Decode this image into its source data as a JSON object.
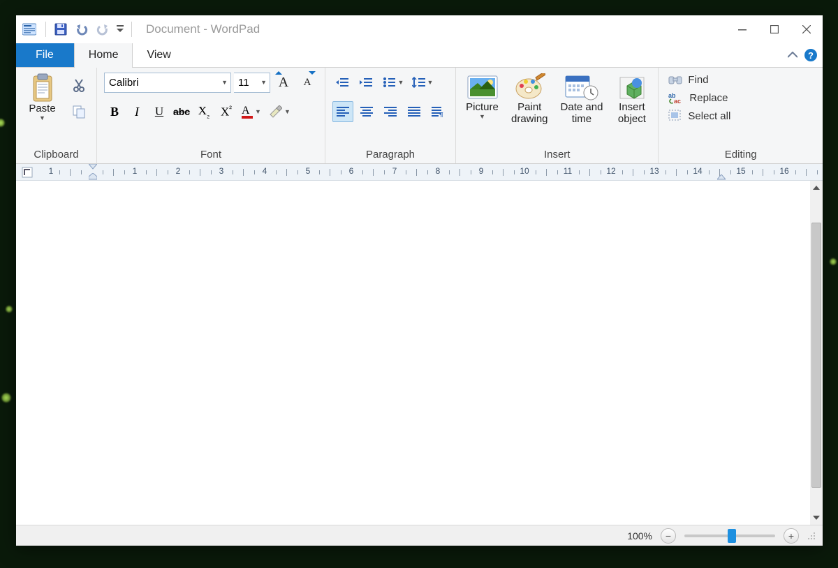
{
  "title": "Document - WordPad",
  "tabs": {
    "file": "File",
    "home": "Home",
    "view": "View"
  },
  "clipboard": {
    "paste": "Paste",
    "label": "Clipboard"
  },
  "font": {
    "family": "Calibri",
    "size": "11",
    "label": "Font"
  },
  "paragraph": {
    "label": "Paragraph"
  },
  "insert": {
    "picture": "Picture",
    "paint": "Paint\ndrawing",
    "datetime": "Date and\ntime",
    "object": "Insert\nobject",
    "label": "Insert"
  },
  "editing": {
    "find": "Find",
    "replace": "Replace",
    "selectall": "Select all",
    "label": "Editing"
  },
  "ruler_numbers": [
    "1",
    "1",
    "2",
    "3",
    "4",
    "5",
    "6",
    "7",
    "8",
    "9",
    "10",
    "11",
    "12",
    "13",
    "14",
    "15",
    "16"
  ],
  "status": {
    "zoom": "100%"
  }
}
